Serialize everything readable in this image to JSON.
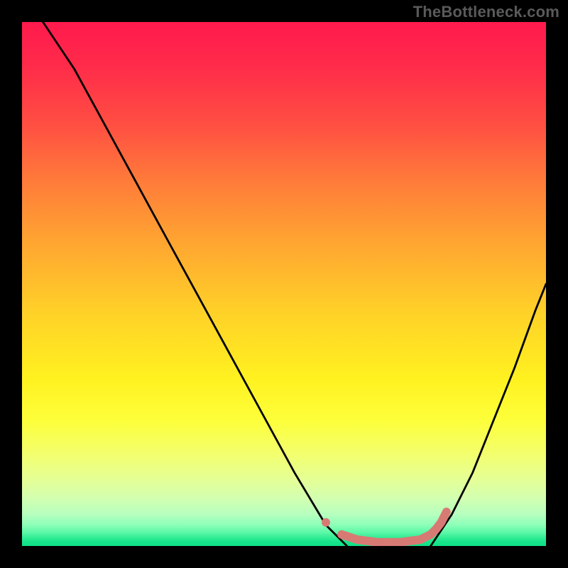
{
  "watermark": "TheBottleneck.com",
  "chart_data": {
    "type": "line",
    "title": "",
    "xlabel": "",
    "ylabel": "",
    "xlim": [
      0,
      100
    ],
    "ylim": [
      0,
      100
    ],
    "grid": false,
    "legend": false,
    "series": [
      {
        "name": "curve-left",
        "color": "#000000",
        "x": [
          4,
          10,
          16,
          22,
          28,
          34,
          40,
          46,
          52,
          58,
          62
        ],
        "y": [
          100,
          91,
          80,
          69,
          58,
          47,
          36,
          25,
          14,
          4,
          0
        ]
      },
      {
        "name": "curve-right",
        "color": "#000000",
        "x": [
          78,
          82,
          86,
          90,
          94,
          98,
          100
        ],
        "y": [
          0,
          6,
          14,
          24,
          34,
          45,
          50
        ]
      },
      {
        "name": "highlight-segment",
        "color": "#d87a74",
        "x": [
          58,
          61,
          64,
          68,
          72,
          76,
          78,
          79,
          80,
          81
        ],
        "y": [
          4.5,
          2.2,
          1.2,
          0.7,
          0.7,
          1.2,
          2.2,
          3.2,
          4.5,
          6.5
        ]
      }
    ],
    "annotations": []
  }
}
